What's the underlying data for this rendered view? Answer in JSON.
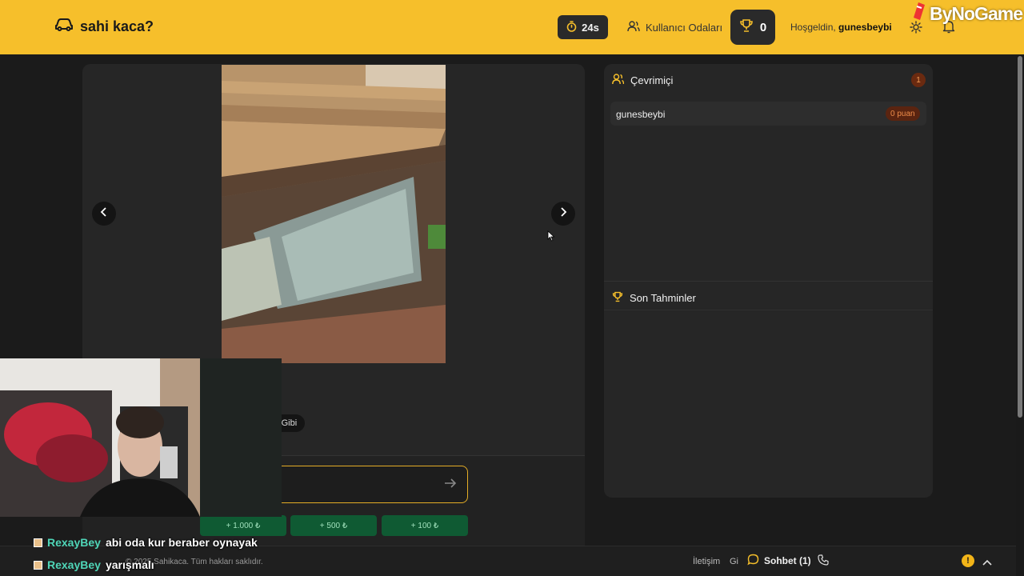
{
  "header": {
    "logo_text": "sahi kaca?",
    "timer": "24s",
    "rooms_label": "Kullanıcı Odaları",
    "trophy_count": "0",
    "welcome_prefix": "Hoşgeldin,",
    "username": "gunesbeybi",
    "accent_color": "#f6bf2b"
  },
  "watermark": {
    "brand": "ByNoGame"
  },
  "listing": {
    "tag_partial": "ni Gibi",
    "quick_bids": [
      "+ 1.000 ₺",
      "+ 500 ₺",
      "+ 100 ₺"
    ]
  },
  "sidebar": {
    "online_title": "Çevrimiçi",
    "online_count": "1",
    "users": [
      {
        "name": "gunesbeybi",
        "points": "0 puan"
      }
    ],
    "recent_title": "Son Tahminler"
  },
  "footer": {
    "copyright": "© 2025 Sahikaca. Tüm hakları saklıdır.",
    "contact": "İletişim",
    "contact2": "Gi",
    "chat_label": "Sohbet (1)",
    "warning": "!"
  },
  "stream_chat": [
    {
      "nick": "RexayBey",
      "message": "abi oda kur beraber oynayak"
    },
    {
      "nick": "RexayBey",
      "message": "yarışmalı"
    }
  ]
}
